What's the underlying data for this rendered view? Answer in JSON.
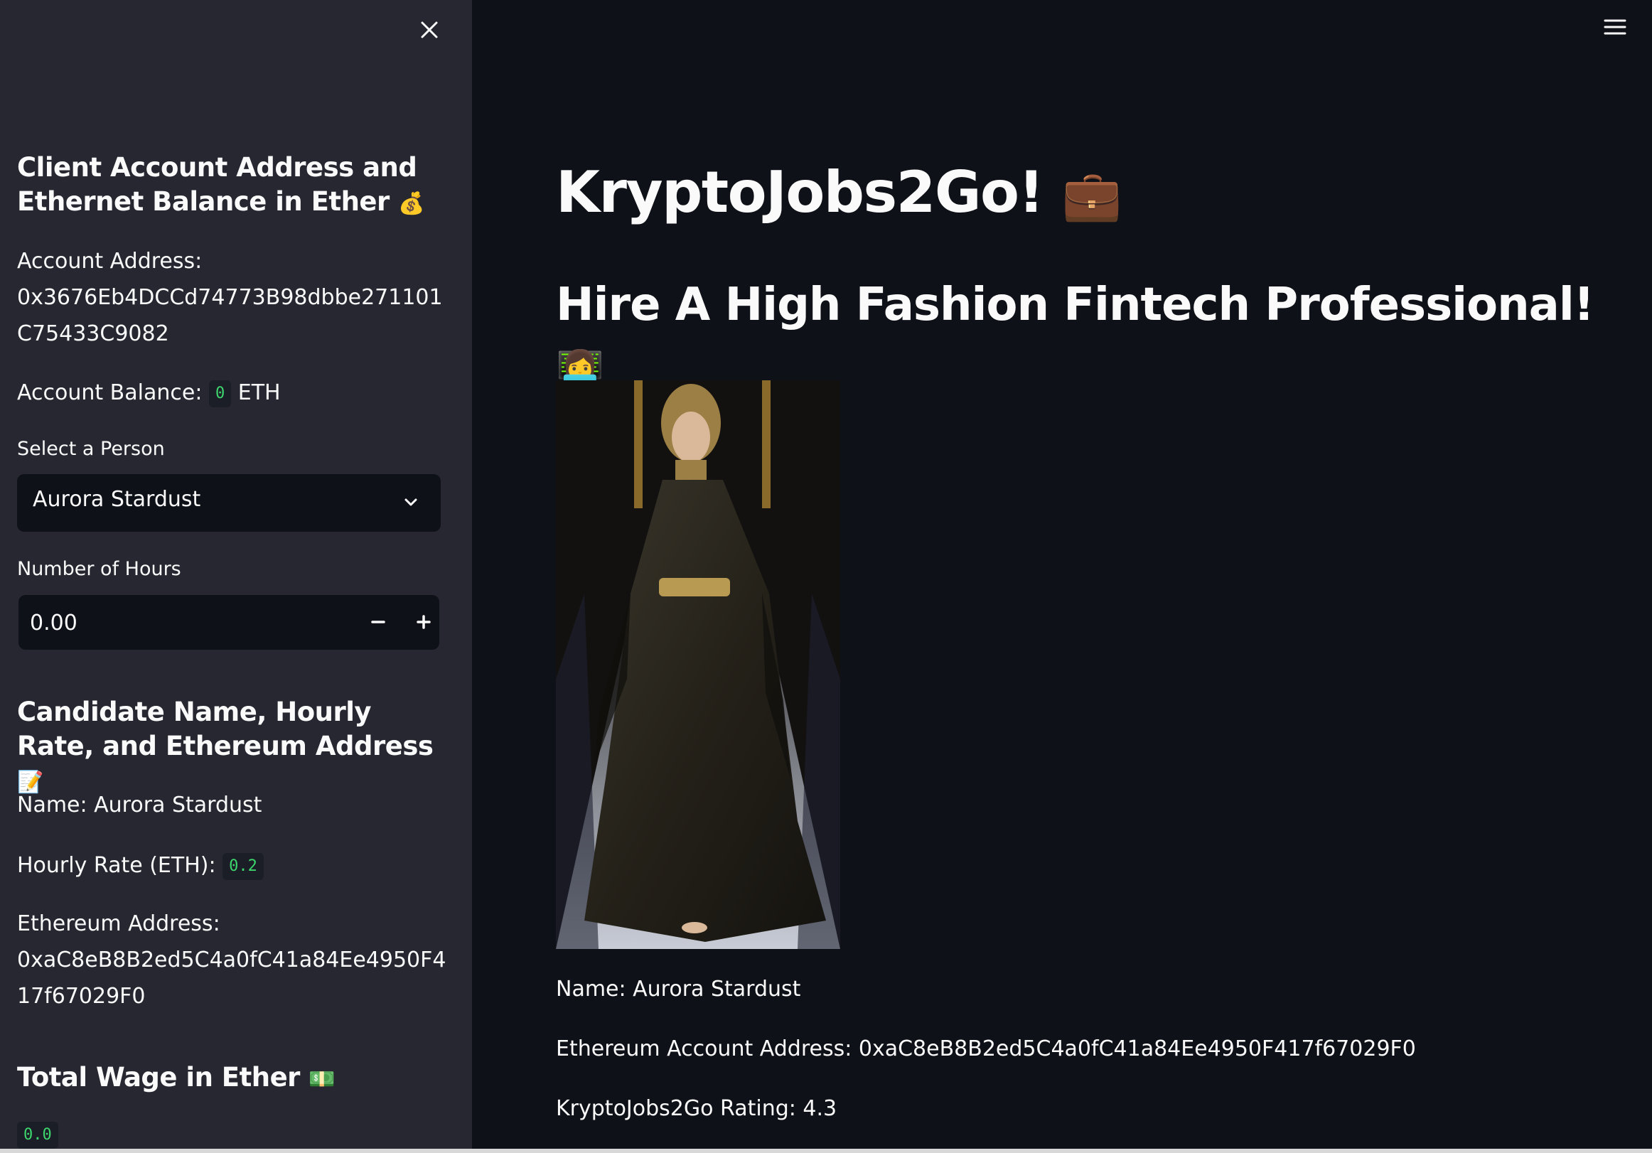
{
  "sidebar": {
    "account_heading": "Client Account Address and Ethernet Balance in Ether",
    "account_heading_emoji": "💰",
    "account_address_label": "Account Address:",
    "account_address_value": "0x3676Eb4DCCd74773B98dbbe271101C75433C9082",
    "account_balance_label": "Account Balance:",
    "account_balance_value": "0",
    "account_balance_unit": "ETH",
    "select_label": "Select a Person",
    "select_value": "Aurora Stardust",
    "hours_label": "Number of Hours",
    "hours_value": "0.00",
    "candidate_heading": "Candidate Name, Hourly Rate, and Ethereum Address",
    "candidate_heading_emoji": "📝",
    "name_line": "Name: Aurora Stardust",
    "hourly_rate_label": "Hourly Rate (ETH):",
    "hourly_rate_value": "0.2",
    "eth_address_label": "Ethereum Address:",
    "eth_address_value": "0xaC8eB8B2ed5C4a0fC41a84Ee4950F417f67029F0",
    "wage_heading": "Total Wage in Ether",
    "wage_heading_emoji": "💵",
    "wage_value": "0.0"
  },
  "main": {
    "title": "KryptoJobs2Go!",
    "title_emoji": "💼",
    "subtitle": "Hire A High Fashion Fintech Professional!",
    "subtitle_emoji": "👩‍💻",
    "candidate_name": "Name: Aurora Stardust",
    "candidate_eth_address": "Ethereum Account Address: 0xaC8eB8B2ed5C4a0fC41a84Ee4950F417f67029F0",
    "candidate_rating": "KryptoJobs2Go Rating: 4.3"
  },
  "icons": {
    "close": "close-icon",
    "menu": "hamburger-menu-icon",
    "chevron": "chevron-down-icon",
    "minus": "minus-icon",
    "plus": "plus-icon"
  },
  "colors": {
    "background": "#0e1117",
    "sidebar": "#262730",
    "code_text": "#3dd56d",
    "text": "#fafafa"
  }
}
